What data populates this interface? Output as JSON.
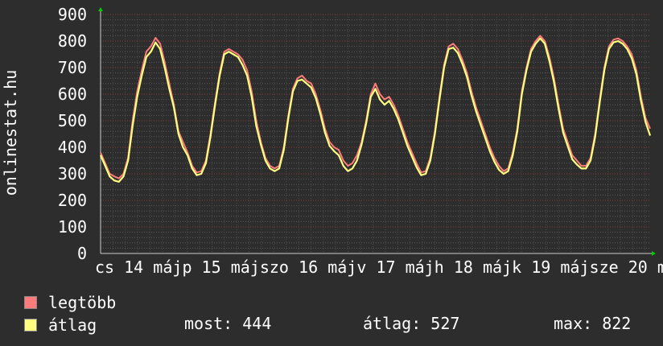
{
  "chart_data": {
    "type": "line",
    "ylabel": "onlinestat.hu",
    "ylim": [
      0,
      900
    ],
    "yticks": [
      0,
      100,
      200,
      300,
      400,
      500,
      600,
      700,
      800,
      900
    ],
    "x_tick_labels": [
      "cs",
      "14",
      "máj",
      "p",
      "15",
      "máj",
      "szo",
      "16",
      "máj",
      "v",
      "17",
      "máj",
      "h",
      "18",
      "máj",
      "k",
      "19",
      "máj",
      "sze",
      "20",
      "máj"
    ],
    "series": [
      {
        "name": "legtöbb",
        "color": "#ff7b7b",
        "values": [
          380,
          340,
          300,
          290,
          283,
          300,
          360,
          500,
          610,
          690,
          760,
          780,
          812,
          790,
          720,
          640,
          560,
          460,
          420,
          380,
          330,
          305,
          310,
          350,
          450,
          570,
          680,
          760,
          770,
          760,
          750,
          730,
          690,
          610,
          500,
          420,
          360,
          330,
          320,
          330,
          400,
          520,
          620,
          660,
          670,
          650,
          640,
          600,
          540,
          470,
          420,
          400,
          390,
          350,
          330,
          340,
          370,
          420,
          500,
          600,
          640,
          600,
          580,
          590,
          560,
          520,
          470,
          420,
          380,
          340,
          305,
          310,
          360,
          460,
          590,
          710,
          780,
          790,
          770,
          730,
          680,
          610,
          550,
          500,
          450,
          400,
          360,
          330,
          310,
          320,
          380,
          470,
          610,
          700,
          770,
          800,
          820,
          800,
          740,
          660,
          560,
          470,
          420,
          370,
          350,
          330,
          330,
          360,
          450,
          580,
          700,
          780,
          805,
          810,
          800,
          780,
          750,
          690,
          590,
          510,
          470
        ]
      },
      {
        "name": "átlag",
        "color": "#ffff80",
        "values": [
          370,
          330,
          290,
          275,
          270,
          290,
          350,
          480,
          590,
          670,
          740,
          760,
          795,
          770,
          700,
          620,
          550,
          450,
          400,
          370,
          320,
          295,
          300,
          340,
          440,
          560,
          670,
          750,
          760,
          750,
          740,
          710,
          670,
          590,
          480,
          410,
          350,
          320,
          310,
          320,
          390,
          510,
          610,
          650,
          655,
          640,
          625,
          585,
          525,
          455,
          405,
          385,
          370,
          330,
          310,
          320,
          350,
          410,
          490,
          590,
          620,
          580,
          560,
          575,
          545,
          505,
          455,
          405,
          365,
          325,
          295,
          300,
          350,
          450,
          580,
          700,
          770,
          775,
          755,
          715,
          665,
          595,
          535,
          485,
          435,
          385,
          345,
          315,
          300,
          310,
          370,
          460,
          600,
          690,
          760,
          790,
          810,
          790,
          725,
          645,
          545,
          455,
          405,
          355,
          335,
          320,
          320,
          350,
          440,
          570,
          690,
          770,
          795,
          800,
          790,
          770,
          735,
          675,
          575,
          495,
          444
        ]
      }
    ]
  },
  "stats": {
    "now": "most: 444",
    "avg": "átlag: 527",
    "max": "max: 822"
  }
}
